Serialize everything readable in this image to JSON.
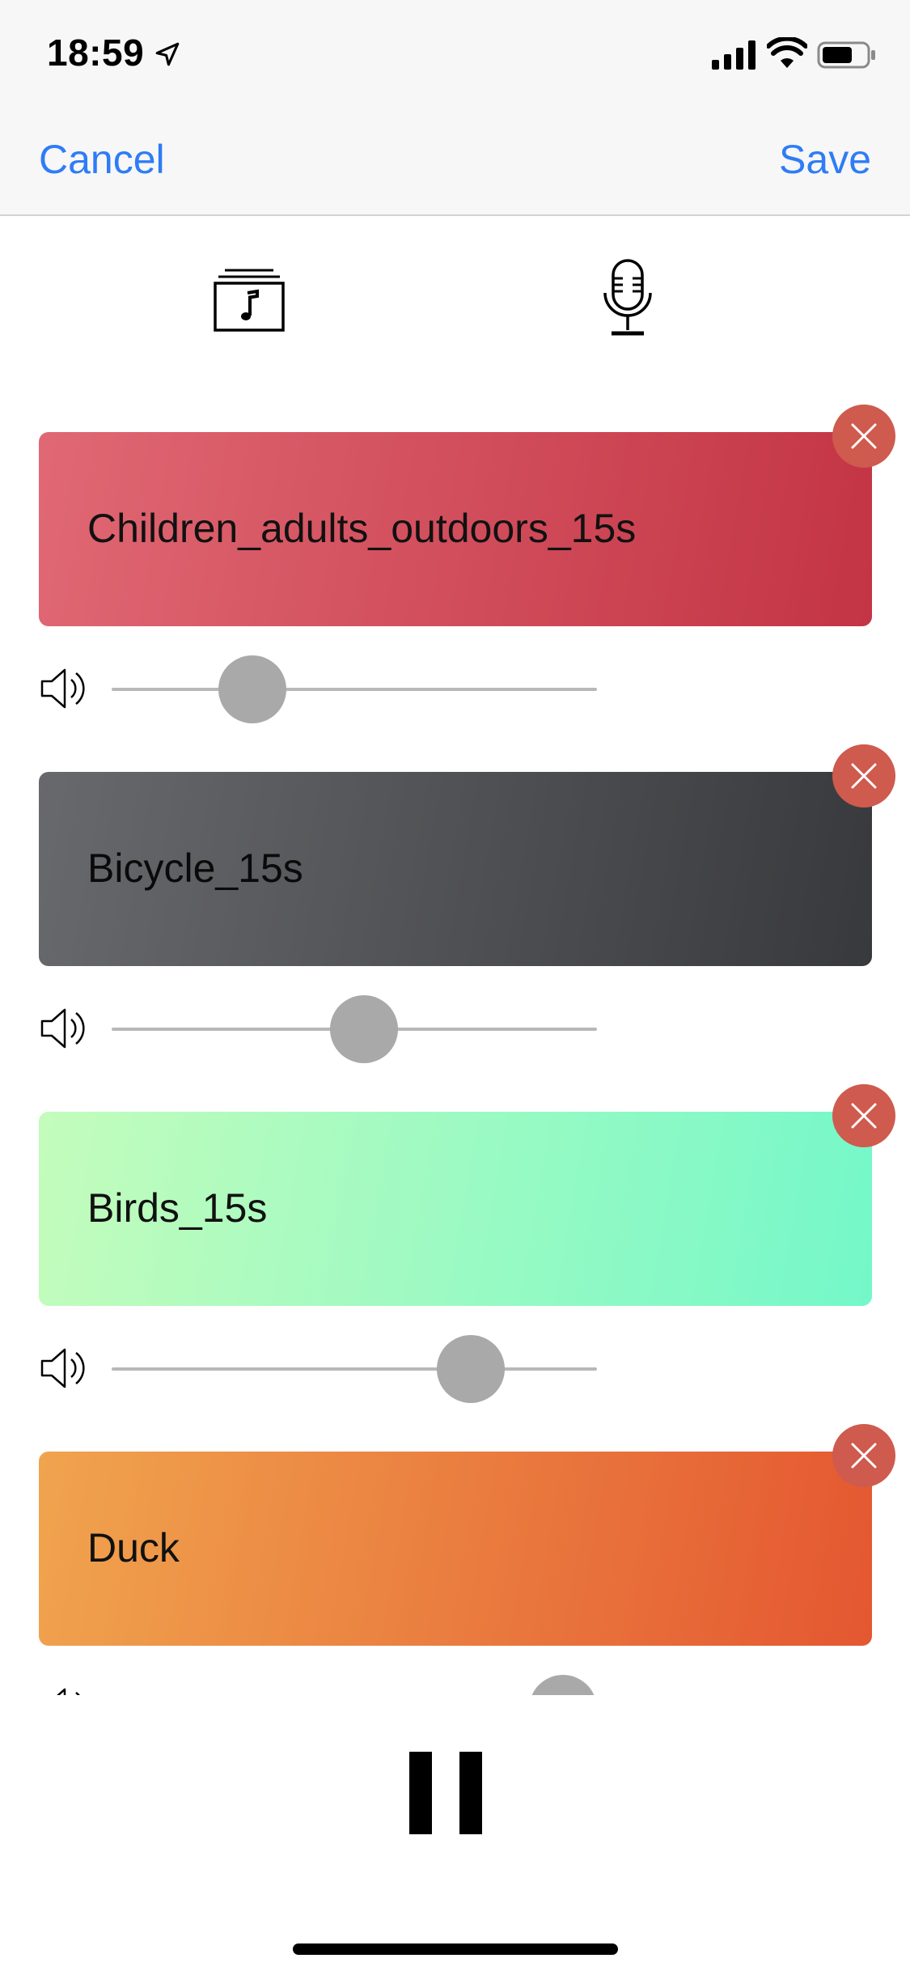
{
  "status_bar": {
    "time": "18:59",
    "icons": [
      "location-arrow-icon",
      "signal-icon",
      "wifi-icon",
      "battery-icon"
    ]
  },
  "nav": {
    "cancel_label": "Cancel",
    "save_label": "Save",
    "accent_color": "#2f7cf6"
  },
  "modes": {
    "icons": [
      "music-library-icon",
      "microphone-icon"
    ]
  },
  "tracks": [
    {
      "title": "Children_adults_outdoors_15s",
      "volume": 0.29,
      "gradient": [
        "#e06874",
        "#c33444"
      ]
    },
    {
      "title": "Bicycle_15s",
      "volume": 0.52,
      "gradient": [
        "#68696c",
        "#38393c"
      ]
    },
    {
      "title": "Birds_15s",
      "volume": 0.74,
      "gradient": [
        "#c4fcbc",
        "#74f8c9"
      ]
    },
    {
      "title": "Duck",
      "volume": 0.93,
      "gradient": [
        "#f0a44e",
        "#e45731"
      ]
    }
  ],
  "controls": {
    "play_state_icon": "pause-icon"
  }
}
